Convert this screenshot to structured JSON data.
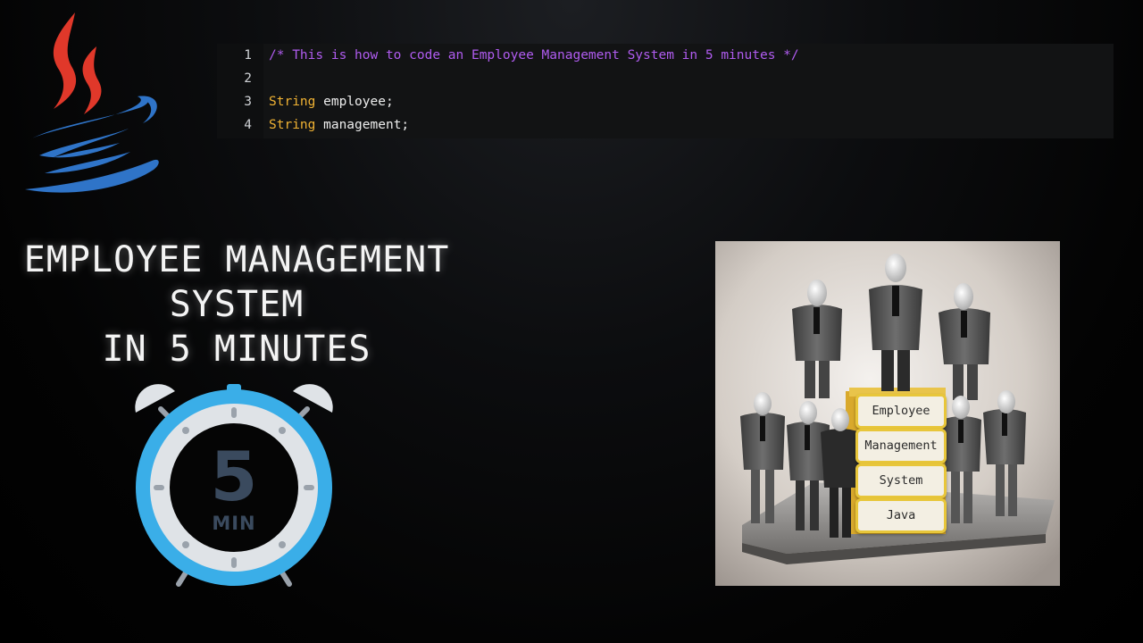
{
  "code_editor": {
    "lines": [
      {
        "number": "1",
        "comment": "/* This is how to code an Employee Management System in 5 minutes */"
      },
      {
        "number": "2"
      },
      {
        "number": "3",
        "type": "String",
        "rest": " employee;"
      },
      {
        "number": "4",
        "type": "String",
        "rest": " management;"
      }
    ],
    "colors": {
      "comment": "#b05cf0",
      "type": "#f0b233",
      "background": "#121314"
    }
  },
  "headline": {
    "line1": "EMPLOYEE MANAGEMENT",
    "line2": "SYSTEM",
    "line3": "IN 5 MINUTES"
  },
  "timer": {
    "number": "5",
    "unit": "MIN",
    "ring_color": "#3aaee8"
  },
  "illustration": {
    "signs": [
      "Employee",
      "Management",
      "System",
      "Java"
    ]
  },
  "icons": {
    "logo": "java-coffee-cup-icon",
    "timer": "alarm-clock-icon"
  }
}
